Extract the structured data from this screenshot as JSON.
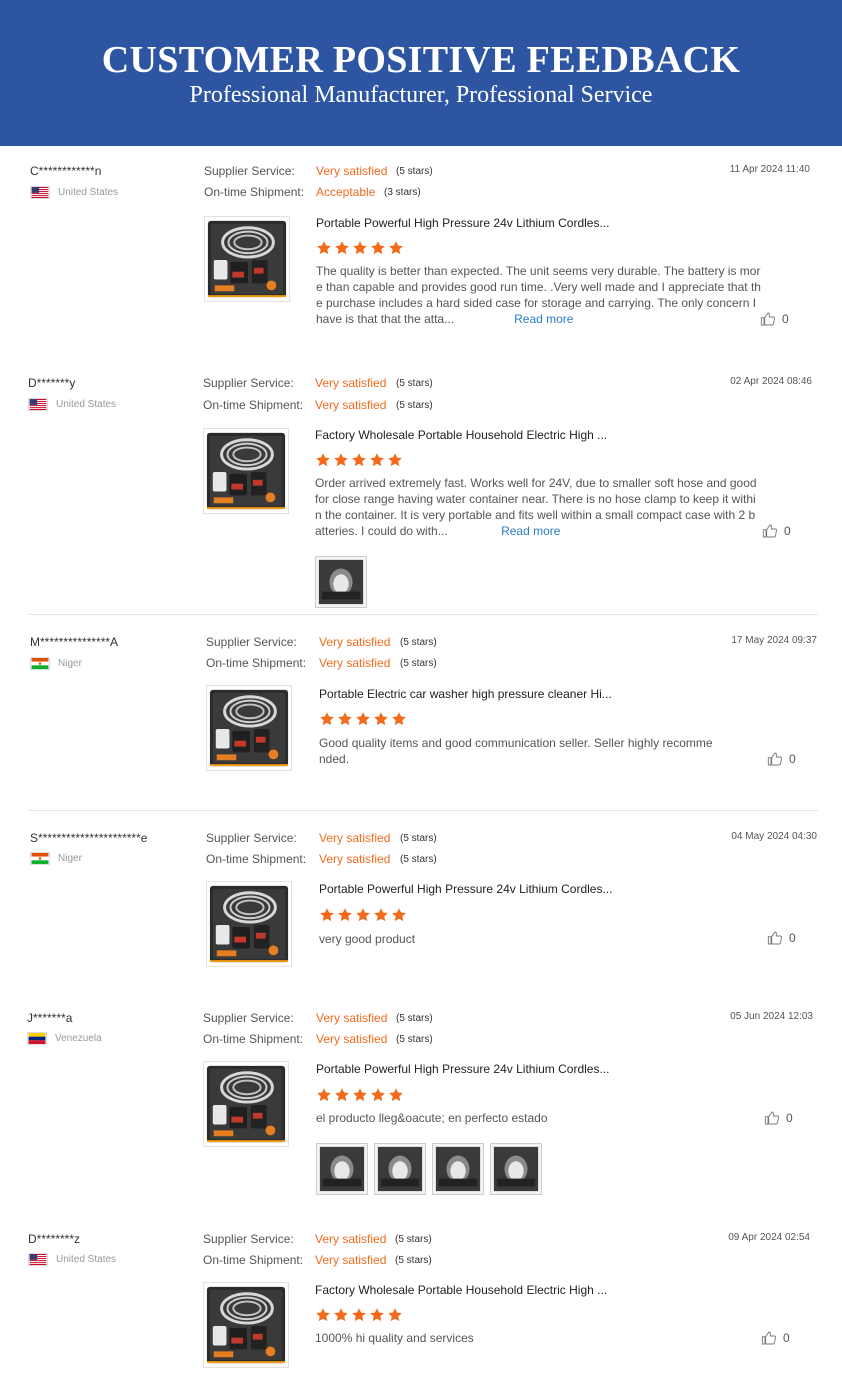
{
  "banner": {
    "title": "CUSTOMER POSITIVE FEEDBACK",
    "subtitle": "Professional Manufacturer, Professional Service"
  },
  "colors": {
    "banner_bg": "#2d55a2",
    "accent_orange": "#f26b1d",
    "link_blue": "#2a7cc7"
  },
  "labels": {
    "supplier_service": "Supplier Service:",
    "on_time_shipment": "On-time Shipment:",
    "read_more": "Read more"
  },
  "reviews": [
    {
      "user": "C************n",
      "country": "United States",
      "flag": "us-flag-icon",
      "supplier_service": "Very satisfied",
      "supplier_stars": "(5 stars)",
      "shipment": "Acceptable",
      "shipment_stars": "(3 stars)",
      "date": "11 Apr 2024 11:40",
      "product": "Portable Powerful High Pressure 24v Lithium Cordles...",
      "rating": 5,
      "text": "The quality is better than expected.  The unit seems very durable.  The battery is more than capable and provides good run time.  .Very well made and I appreciate that the purchase includes a hard sided case for storage and carrying.  The only concern I have is that that the atta...",
      "likes": "0"
    },
    {
      "user": "D*******y",
      "country": "United States",
      "flag": "us-flag-icon",
      "supplier_service": "Very satisfied",
      "supplier_stars": "(5 stars)",
      "shipment": "Very satisfied",
      "shipment_stars": "(5 stars)",
      "date": "02 Apr 2024 08:46",
      "product": "Factory Wholesale Portable Household Electric High ...",
      "rating": 5,
      "text": "Order arrived extremely fast. Works well for 24V, due to smaller soft hose and good for close range having water container near. There is no hose clamp to keep it within the container. It is very portable and fits well within a small compact case with 2 batteries. I could do with...",
      "likes": "0"
    },
    {
      "user": "M***************A",
      "country": "Niger",
      "flag": "niger-flag-icon",
      "supplier_service": "Very satisfied",
      "supplier_stars": "(5 stars)",
      "shipment": "Very satisfied",
      "shipment_stars": "(5 stars)",
      "date": "17 May 2024 09:37",
      "product": "Portable Electric car washer high pressure cleaner Hi...",
      "rating": 5,
      "text": "Good quality items and good communication seller. Seller highly recommended.",
      "likes": "0"
    },
    {
      "user": "S**********************e",
      "country": "Niger",
      "flag": "niger-flag-icon",
      "supplier_service": "Very satisfied",
      "supplier_stars": "(5 stars)",
      "shipment": "Very satisfied",
      "shipment_stars": "(5 stars)",
      "date": "04 May 2024 04:30",
      "product": "Portable Powerful High Pressure 24v Lithium Cordles...",
      "rating": 5,
      "text": "very good product",
      "likes": "0"
    },
    {
      "user": "J*******a",
      "country": "Venezuela",
      "flag": "venezuela-flag-icon",
      "supplier_service": "Very satisfied",
      "supplier_stars": "(5 stars)",
      "shipment": "Very satisfied",
      "shipment_stars": "(5 stars)",
      "date": "05 Jun 2024 12:03",
      "product": "Portable Powerful High Pressure 24v Lithium Cordles...",
      "rating": 5,
      "text": "el producto lleg&oacute; en perfecto estado",
      "likes": "0"
    },
    {
      "user": "D********z",
      "country": "United States",
      "flag": "us-flag-icon",
      "supplier_service": "Very satisfied",
      "supplier_stars": "(5 stars)",
      "shipment": "Very satisfied",
      "shipment_stars": "(5 stars)",
      "date": "09 Apr 2024 02:54",
      "product": "Factory Wholesale Portable Household Electric High ...",
      "rating": 5,
      "text": "1000% hi quality and services",
      "likes": "0"
    }
  ]
}
